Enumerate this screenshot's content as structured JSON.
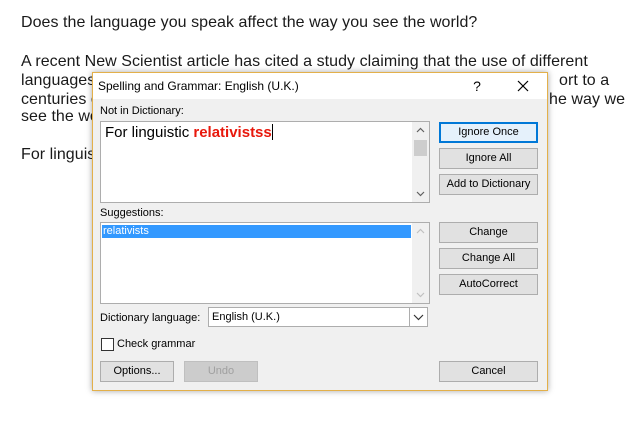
{
  "document": {
    "line1": "Does the language you speak affect the way you see the world?",
    "line2a": "A recent New Scientist article has cited a study claiming that the use of different",
    "line3a": "languages",
    "line3b": "ort to a",
    "line4a": "centuries o",
    "line4b": "he way we",
    "line5a": "see the wo",
    "line6a": "For linguis"
  },
  "dialog": {
    "title": "Spelling and Grammar: English (U.K.)",
    "help_label": "?",
    "not_in_dictionary_label": "Not in Dictionary:",
    "text_normal": "For linguistic ",
    "text_error": "relativistss",
    "suggestions_label": "Suggestions:",
    "suggestions": [
      "relativists"
    ],
    "dictionary_language_label": "Dictionary language:",
    "dictionary_language_value": "English (U.K.)",
    "check_grammar_label": "Check grammar",
    "buttons": {
      "ignore_once": "Ignore Once",
      "ignore_all": "Ignore All",
      "add_to_dictionary": "Add to Dictionary",
      "change": "Change",
      "change_all": "Change All",
      "autocorrect": "AutoCorrect",
      "options": "Options...",
      "undo": "Undo",
      "cancel": "Cancel"
    }
  },
  "colors": {
    "error_text": "#e8180c",
    "selection": "#3399ff",
    "focus_border": "#0078d7",
    "dialog_border": "#e3b04a"
  }
}
